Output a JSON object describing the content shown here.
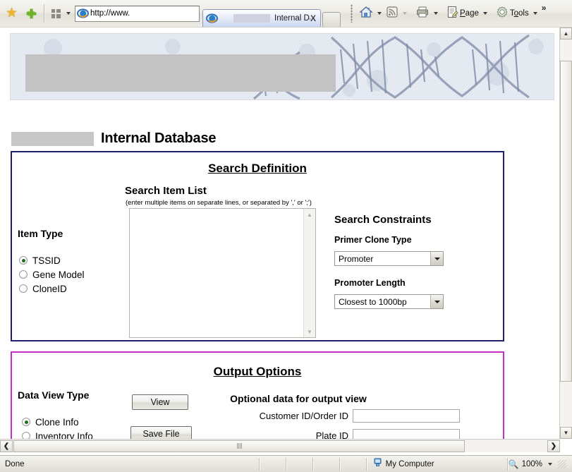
{
  "browser": {
    "favorites_icon": "star-icon",
    "add_favorite_icon": "add-favorite-icon",
    "quick_tabs_icon": "quick-tabs-icon",
    "address_value": "http://www.",
    "address_placeholder": "http://www.",
    "tab_title": "Internal Data...",
    "tab_close_label": "X",
    "home_icon": "home-icon",
    "feeds_icon": "rss-feed-icon",
    "print_icon": "printer-icon",
    "page_menu_label": "Page",
    "tools_menu_label": "Tools",
    "overflow_label": "»"
  },
  "page": {
    "banner_alt": "dna-helix-banner",
    "title": "Internal Database"
  },
  "search_definition": {
    "heading": "Search Definition",
    "item_type": {
      "label": "Item Type",
      "options": [
        {
          "label": "TSSID",
          "checked": true
        },
        {
          "label": "Gene Model",
          "checked": false
        },
        {
          "label": "CloneID",
          "checked": false
        }
      ]
    },
    "search_item_list": {
      "label": "Search Item List",
      "hint": "(enter multiple items on separate lines, or separated by ',' or ';')",
      "value": "",
      "placeholder": ""
    },
    "constraints": {
      "heading": "Search Constraints",
      "primer_clone_type": {
        "label": "Primer Clone Type",
        "value": "Promoter",
        "options": [
          "Promoter"
        ]
      },
      "promoter_length": {
        "label": "Promoter Length",
        "value": "Closest to 1000bp",
        "options": [
          "Closest to 1000bp"
        ]
      }
    }
  },
  "output_options": {
    "heading": "Output Options",
    "data_view_type": {
      "label": "Data View Type",
      "options": [
        {
          "label": "Clone Info",
          "checked": true
        },
        {
          "label": "Inventory Info",
          "checked": false
        }
      ]
    },
    "view_button": "View",
    "save_file_button": "Save File",
    "optional": {
      "heading": "Optional data for output view",
      "fields": [
        {
          "label": "Customer ID/Order ID",
          "value": "",
          "placeholder": ""
        },
        {
          "label": "Plate ID",
          "value": "",
          "placeholder": ""
        }
      ]
    }
  },
  "status_bar": {
    "status_text": "Done",
    "zone_label": "My Computer",
    "zone_icon": "my-computer-icon",
    "zoom_level": "100%",
    "zoom_icon": "magnifier-icon"
  },
  "colors": {
    "search_panel_border": "#20206b",
    "output_panel_border": "#c62fc6",
    "radio_dot": "#1f6f1f"
  }
}
